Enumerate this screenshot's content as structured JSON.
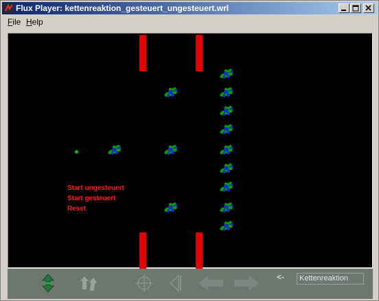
{
  "window": {
    "title": "Flux Player: kettenreaktion_gesteuert_ungesteuert.wrl"
  },
  "menu": {
    "items": [
      {
        "label": "File"
      },
      {
        "label": "Help"
      }
    ]
  },
  "scene": {
    "background": "#000000",
    "pillar_color": "#e00000",
    "molecule_colors": [
      "#00a000",
      "#1a2ecc"
    ],
    "links": [
      {
        "label": "Start ungesteuert"
      },
      {
        "label": "Start gesteuert"
      },
      {
        "label": "Reset"
      }
    ],
    "link_color": "#ff1a1a"
  },
  "toolbar": {
    "tools": [
      {
        "icon": "walk-icon"
      },
      {
        "icon": "rotate-icon"
      },
      {
        "icon": "crosshair-icon"
      },
      {
        "icon": "restore-view-icon"
      },
      {
        "icon": "arrow-left-icon"
      },
      {
        "icon": "arrow-right-icon"
      }
    ],
    "viewpoint_prev_label": "<-",
    "viewpoint_value": "Kettenreaktion"
  }
}
